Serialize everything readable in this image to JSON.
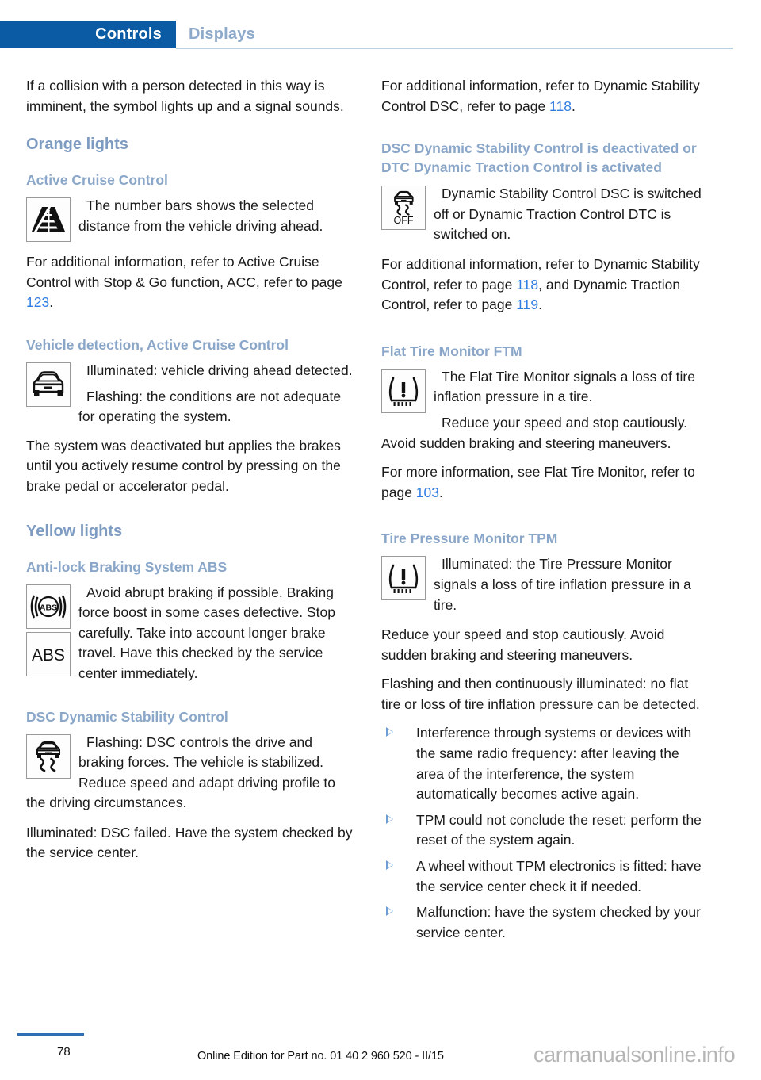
{
  "header": {
    "active_tab": "Controls",
    "inactive_tab": "Displays",
    "accent_color": "#0a5ba3",
    "rule_color": "#b9cfe4"
  },
  "left_column": {
    "intro_paragraph": "If a collision with a person detected in this way is imminent, the symbol lights up and a signal sounds.",
    "section_orange": "Orange lights",
    "acc": {
      "heading": "Active Cruise Control",
      "icon": "distance-bars-icon",
      "icon_text": "The number bars shows the selected distance from the vehicle driving ahead.",
      "followup_pre": "For additional information, refer to Active Cruise Control with Stop & Go function, ACC, refer to page ",
      "followup_page": "123",
      "followup_post": "."
    },
    "vehicle_detection": {
      "heading": "Vehicle detection, Active Cruise Control",
      "icon": "car-front-icon",
      "icon_text": "Illuminated: vehicle driving ahead detected.",
      "flashing_text": "Flashing: the conditions are not adequate for operating the system.",
      "body_text": "The system was deactivated but applies the brakes until you actively resume control by pressing on the brake pedal or accelerator pedal."
    },
    "section_yellow": "Yellow lights",
    "abs": {
      "heading": "Anti-lock Braking System ABS",
      "icon_1": "abs-brake-warning-icon",
      "icon_2": "abs-label-icon",
      "icon_2_label": "ABS",
      "icon_text": "Avoid abrupt braking if possible. Braking force boost in some cases defective. Stop carefully. Take into account longer brake travel. Have this checked by the service center immediately."
    },
    "dsc": {
      "heading": "DSC Dynamic Stability Control",
      "icon": "dsc-skid-icon",
      "icon_text": "Flashing: DSC controls the drive and braking forces. The vehicle is stabilized. Reduce speed and adapt driving profile to the driving circumstances.",
      "body_text": "Illuminated: DSC failed. Have the system checked by the service center."
    }
  },
  "right_column": {
    "dsc_ref": {
      "pre": "For additional information, refer to Dynamic Stability Control DSC, refer to page ",
      "page": "118",
      "post": "."
    },
    "dsc_off": {
      "heading": "DSC Dynamic Stability Control is deactivated or DTC Dynamic Traction Control is activated",
      "icon": "dsc-off-icon",
      "icon_label": "OFF",
      "icon_text": "Dynamic Stability Control DSC is switched off or Dynamic Traction Control DTC is switched on.",
      "ref_pre": "For additional information, refer to Dynamic Stability Control, refer to page ",
      "ref_page_1": "118",
      "ref_mid": ", and Dynamic Traction Control, refer to page ",
      "ref_page_2": "119",
      "ref_post": "."
    },
    "ftm": {
      "heading": "Flat Tire Monitor FTM",
      "icon": "tire-pressure-warning-icon",
      "icon_text": "The Flat Tire Monitor signals a loss of tire inflation pressure in a tire.",
      "reduce_text": "Reduce your speed and stop cautiously. Avoid sudden braking and steering maneuvers.",
      "ref_pre": "For more information, see Flat Tire Monitor, refer to page ",
      "ref_page": "103",
      "ref_post": "."
    },
    "tpm": {
      "heading": "Tire Pressure Monitor TPM",
      "icon": "tire-pressure-warning-icon",
      "icon_text": "Illuminated: the Tire Pressure Monitor signals a loss of tire inflation pressure in a tire.",
      "reduce_text": "Reduce your speed and stop cautiously. Avoid sudden braking and steering maneuvers.",
      "flashing_text": "Flashing and then continuously illuminated: no flat tire or loss of tire inflation pressure can be detected.",
      "bullets": [
        "Interference through systems or devices with the same radio frequency: after leaving the area of the interference, the system automatically becomes active again.",
        "TPM could not conclude the reset: perform the reset of the system again.",
        "A wheel without TPM electronics is fitted: have the service center check it if needed.",
        "Malfunction: have the system checked by your service center."
      ]
    }
  },
  "footer": {
    "page_number": "78",
    "edition": "Online Edition for Part no. 01 40 2 960 520 - II/15",
    "watermark": "carmanualsonline.info"
  }
}
